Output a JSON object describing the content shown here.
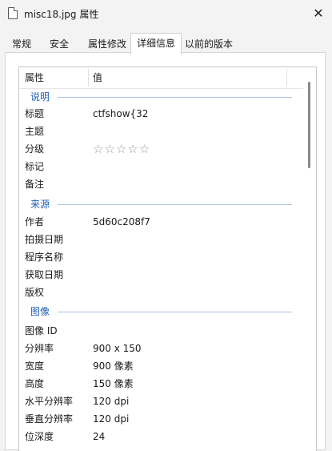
{
  "window": {
    "title": "misc18.jpg 属性",
    "close_glyph": "✕"
  },
  "tabs": [
    {
      "label": "常规"
    },
    {
      "label": "安全"
    },
    {
      "label": "属性修改"
    },
    {
      "label": "详细信息"
    },
    {
      "label": "以前的版本"
    }
  ],
  "active_tab": "详细信息",
  "columns": {
    "property": "属性",
    "value": "值"
  },
  "sections": {
    "description": "说明",
    "origin": "来源",
    "image": "图像"
  },
  "rows": {
    "title": {
      "name": "标题",
      "value": "ctfshow{32"
    },
    "subject": {
      "name": "主题",
      "value": ""
    },
    "rating": {
      "name": "分级",
      "stars": 5,
      "filled": 0,
      "glyph": "☆☆☆☆☆"
    },
    "tags": {
      "name": "标记",
      "value": ""
    },
    "comments": {
      "name": "备注",
      "value": ""
    },
    "author": {
      "name": "作者",
      "value": "5d60c208f7"
    },
    "date_taken": {
      "name": "拍摄日期",
      "value": ""
    },
    "program": {
      "name": "程序名称",
      "value": ""
    },
    "date_acquired": {
      "name": "获取日期",
      "value": ""
    },
    "copyright": {
      "name": "版权",
      "value": ""
    },
    "image_id": {
      "name": "图像 ID",
      "value": ""
    },
    "dimensions": {
      "name": "分辨率",
      "value": "900 x 150"
    },
    "width": {
      "name": "宽度",
      "value": "900 像素"
    },
    "height": {
      "name": "高度",
      "value": "150 像素"
    },
    "hres": {
      "name": "水平分辨率",
      "value": "120 dpi"
    },
    "vres": {
      "name": "垂直分辨率",
      "value": "120 dpi"
    },
    "bitdepth": {
      "name": "位深度",
      "value": "24"
    }
  },
  "icons": {
    "file": "file-icon",
    "close": "close-icon",
    "star": "star-outline-icon"
  },
  "colors": {
    "section_label": "#1f5fb8",
    "section_line": "#a9c1e2",
    "panel_bg": "#ffffff",
    "window_bg": "#f3f3f3"
  }
}
